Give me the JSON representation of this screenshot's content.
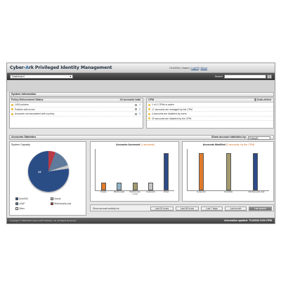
{
  "app": {
    "logo_part1": "Cyber-",
    "logo_arc": "A",
    "logo_part2": "rk",
    "title": "Privileged Identity Management"
  },
  "toplinks": {
    "date": "7/14/2010",
    "user": "Karen",
    "logoff": "LogOff",
    "about": "About"
  },
  "nav": {
    "dashboard_selected": "Dashboard",
    "search_label": "Search"
  },
  "system_info": {
    "heading": "System Information",
    "policy": {
      "title": "Policy Enforcement Status",
      "total": "24 accounts total",
      "rows": [
        {
          "label": "1400 policies",
          "count": "1"
        },
        {
          "label": "Policies with errors",
          "count": "2"
        },
        {
          "label": "Accounts not associated with a policy",
          "count": "3"
        }
      ]
    },
    "cpm": {
      "title": "CPM",
      "auto_detect": "Auto-detect",
      "rows": [
        {
          "label": "1 of 1 CPMs is active"
        },
        {
          "label": "17 accounts are managed by the CPM"
        },
        {
          "label": "4 accounts are disabled by users"
        },
        {
          "label": "20 accounts are disabled by the CPM"
        }
      ]
    }
  },
  "account_stats": {
    "heading": "Accounts Statistics",
    "show_by_label": "Show account statistics by:",
    "show_by_value": "PolicyID",
    "capacity": {
      "title": "System Capacity",
      "slice_label": "13",
      "legend": [
        "UnixSSH",
        "Oracle",
        "LDAP",
        "WinDomainLocal",
        "Other"
      ]
    },
    "activity_label": "Show account activity for:",
    "activity_buttons": [
      "Last 24 hours",
      "Last 48 hours",
      "Last 7 days",
      "Last month",
      "Last quarter"
    ],
    "activity_active": "Last quarter"
  },
  "footer": {
    "copyright": "Copyright © 1999-2010 Cyber-Ark® Software, Ltd. All Rights Reserved.",
    "updated": "Information updated: 7/14/2010 5:09:17PM"
  },
  "colors": {
    "bar_orange": "#e07a2a",
    "bar_olive": "#a39a6d",
    "bar_grey": "#c7c7c7",
    "bar_navy": "#2e4a87",
    "bar_teal": "#8fb3c4"
  },
  "chart_data": [
    {
      "type": "pie",
      "title": "System Capacity",
      "labels": [
        "UnixSSH",
        "Oracle",
        "LDAP",
        "WinDomainLocal",
        "Other"
      ],
      "values": [
        13,
        4,
        1,
        1,
        0
      ]
    },
    {
      "type": "bar",
      "title": "Accounts Accessed",
      "title_suffix": "(1 accounts)",
      "categories": [
        "Oracle",
        "WinDomain",
        "WinDomain Local",
        "CyberArk",
        "Other"
      ],
      "values": [
        3,
        3,
        3,
        3,
        15
      ]
    },
    {
      "type": "bar",
      "title": "Accounts Modified",
      "title_suffix": "(2 accounts, by the CPM)",
      "categories": [
        "CyberArk",
        "UnixSSH",
        "WinDomainLocal"
      ],
      "values": [
        15,
        15,
        15
      ]
    }
  ]
}
